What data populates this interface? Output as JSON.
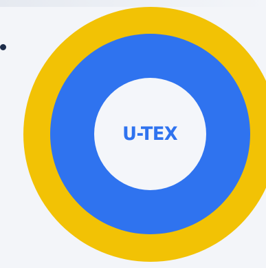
{
  "logo": {
    "text": "U-TEX"
  },
  "colors": {
    "outer_ring": "#f2c205",
    "middle_ring": "#2f73ef",
    "inner_circle": "#f4f6fa",
    "logo_text": "#2f73ef",
    "background": "#f3f5f9",
    "dot": "#1d2c4a"
  }
}
